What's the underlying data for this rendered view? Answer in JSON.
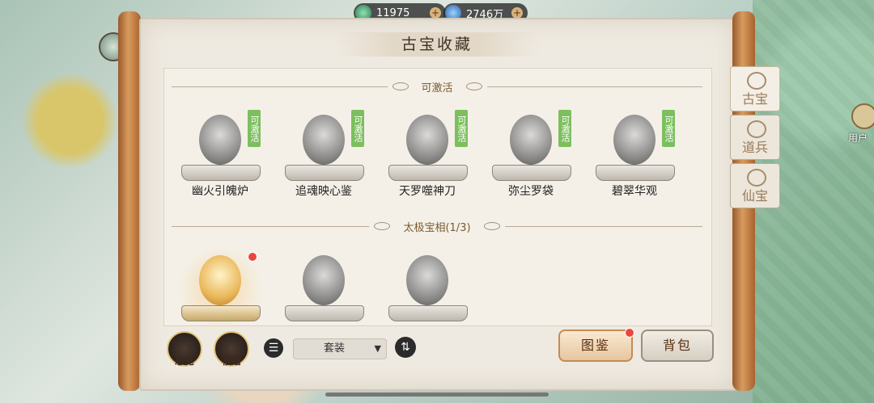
{
  "currency": [
    {
      "icon": "jade-coin-icon",
      "value": "11975"
    },
    {
      "icon": "spirit-stone-icon",
      "value": "2746万"
    }
  ],
  "panel": {
    "title": "古宝收藏",
    "section_activatable": "可激活",
    "section_taiji": "太极宝相(1/3)"
  },
  "items": [
    {
      "name": "幽火引魄炉",
      "badge": "可激活"
    },
    {
      "name": "追魂映心鉴",
      "badge": "可激活"
    },
    {
      "name": "天罗噬神刀",
      "badge": "可激活"
    },
    {
      "name": "弥尘罗袋",
      "badge": "可激活"
    },
    {
      "name": "碧翠华观",
      "badge": "可激活"
    }
  ],
  "taiji_items": [
    {
      "icon": "crescent-moon-relic-icon",
      "selected": true
    },
    {
      "icon": "yin-yang-relic-icon",
      "selected": false
    },
    {
      "icon": "pagoda-relic-icon",
      "selected": false
    }
  ],
  "bottom": {
    "overview": "总览",
    "gift": "福赠",
    "filter_value": "套装",
    "catalog": "图鉴",
    "bag": "背包"
  },
  "tabs": [
    {
      "label": "古宝",
      "active": true
    },
    {
      "label": "道兵",
      "active": false
    },
    {
      "label": "仙宝",
      "active": false
    }
  ],
  "side": {
    "user": "用户"
  }
}
